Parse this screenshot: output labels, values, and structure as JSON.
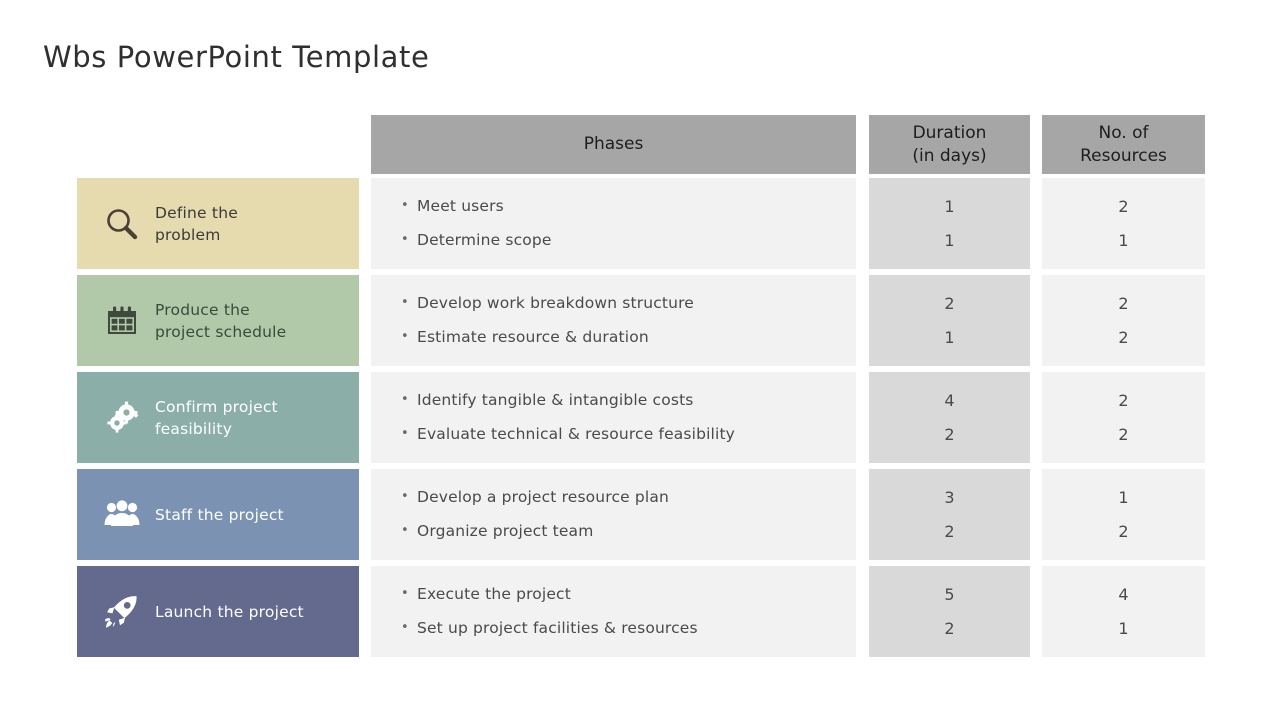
{
  "title": "Wbs PowerPoint Template",
  "colors": {
    "header_bg": "#a6a6a6",
    "phase_cell_bg": "#f2f2f2",
    "duration_cell_bg": "#d9d9d9",
    "resources_cell_bg": "#f2f2f2",
    "step_1_bg": "#e6dbaf",
    "step_2_bg": "#b1c9a9",
    "step_3_bg": "#8bafa8",
    "step_4_bg": "#7b92b3",
    "step_5_bg": "#646a8e"
  },
  "headers": {
    "phases": "Phases",
    "duration_line1": "Duration",
    "duration_line2": "(in days)",
    "resources_line1": "No. of",
    "resources_line2": "Resources"
  },
  "steps": [
    {
      "icon": "magnifier-icon",
      "label_line1": "Define the",
      "label_line2": "problem",
      "bg": "#e6dbaf",
      "text_color": "#3a3a3a"
    },
    {
      "icon": "calendar-icon",
      "label_line1": "Produce the",
      "label_line2": "project schedule",
      "bg": "#b1c9a9",
      "text_color": "#3a4a3a"
    },
    {
      "icon": "gears-icon",
      "label_line1": "Confirm project",
      "label_line2": "feasibility",
      "bg": "#8bafa8",
      "text_color": "#ffffff"
    },
    {
      "icon": "people-icon",
      "label_line1": "Staff the project",
      "label_line2": "",
      "bg": "#7b92b3",
      "text_color": "#ffffff"
    },
    {
      "icon": "rocket-icon",
      "label_line1": "Launch the project",
      "label_line2": "",
      "bg": "#646a8e",
      "text_color": "#ffffff"
    }
  ],
  "rows": [
    {
      "phases": [
        "Meet users",
        "Determine scope"
      ],
      "duration": [
        "1",
        "1"
      ],
      "resources": [
        "2",
        "1"
      ]
    },
    {
      "phases": [
        "Develop work breakdown structure",
        "Estimate resource & duration"
      ],
      "duration": [
        "2",
        "1"
      ],
      "resources": [
        "2",
        "2"
      ]
    },
    {
      "phases": [
        "Identify tangible & intangible costs",
        "Evaluate technical & resource feasibility"
      ],
      "duration": [
        "4",
        "2"
      ],
      "resources": [
        "2",
        "2"
      ]
    },
    {
      "phases": [
        "Develop a project resource plan",
        "Organize project team"
      ],
      "duration": [
        "3",
        "2"
      ],
      "resources": [
        "1",
        "2"
      ]
    },
    {
      "phases": [
        "Execute the project",
        "Set up project facilities & resources"
      ],
      "duration": [
        "5",
        "2"
      ],
      "resources": [
        "4",
        "1"
      ]
    }
  ],
  "bullet_glyph": "•"
}
